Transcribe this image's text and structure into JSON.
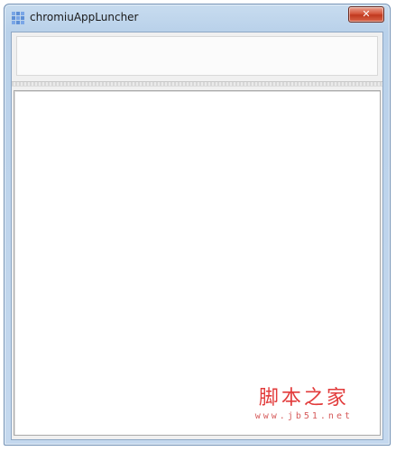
{
  "window": {
    "title": "chromiuAppLuncher",
    "close_label": "✕",
    "colors": {
      "titlebar": "#b9d1ea",
      "close_button": "#c0391f",
      "client_background": "#f0f0f0"
    }
  },
  "watermark": {
    "text": "脚本之家",
    "url": "www.jb51.net",
    "color": "#e23b3b"
  },
  "icons": {
    "app": "app-grid-icon",
    "close": "close-icon"
  }
}
